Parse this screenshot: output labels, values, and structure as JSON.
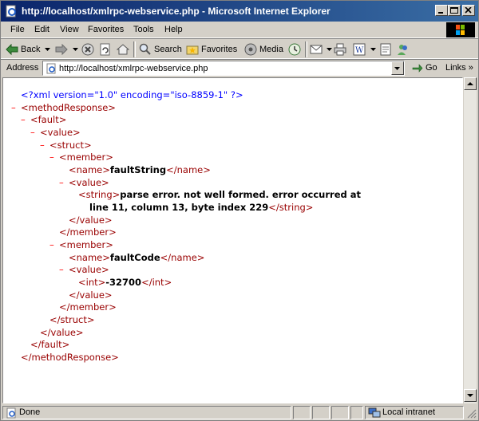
{
  "window": {
    "title": "http://localhost/xmlrpc-webservice.php - Microsoft Internet Explorer"
  },
  "menu": {
    "items": [
      "File",
      "Edit",
      "View",
      "Favorites",
      "Tools",
      "Help"
    ]
  },
  "toolbar": {
    "back_label": "Back",
    "search_label": "Search",
    "favorites_label": "Favorites",
    "media_label": "Media"
  },
  "address": {
    "label": "Address",
    "url": "http://localhost/xmlrpc-webservice.php",
    "go_label": "Go",
    "links_label": "Links"
  },
  "xml": {
    "minus": "–",
    "declaration": "<?xml version=\"1.0\" encoding=\"iso-8859-1\" ?>",
    "methodResponse_open": "<methodResponse>",
    "methodResponse_close": "</methodResponse>",
    "fault_open": "<fault>",
    "fault_close": "</fault>",
    "value_open": "<value>",
    "value_close": "</value>",
    "struct_open": "<struct>",
    "struct_close": "</struct>",
    "member_open": "<member>",
    "member_close": "</member>",
    "name_open": "<name>",
    "name_close": "</name>",
    "string_open": "<string>",
    "string_close": "</string>",
    "int_open": "<int>",
    "int_close": "</int>",
    "fault_string_name": "faultString",
    "fault_string_value_line1": "parse error. not well formed. error occurred at",
    "fault_string_value_line2": "line 11, column 13, byte index 229",
    "fault_code_name": "faultCode",
    "fault_code_value": "-32700"
  },
  "status": {
    "text": "Done",
    "zone": "Local intranet"
  },
  "icons": {
    "back": "back-arrow-icon",
    "forward": "forward-arrow-icon",
    "stop": "stop-icon",
    "refresh": "refresh-icon",
    "home": "home-icon",
    "search": "search-icon",
    "favorites": "favorites-icon",
    "media": "media-icon",
    "history": "history-icon",
    "mail": "mail-icon",
    "print": "print-icon",
    "edit": "edit-icon",
    "discuss": "discuss-icon",
    "messenger": "messenger-icon"
  }
}
